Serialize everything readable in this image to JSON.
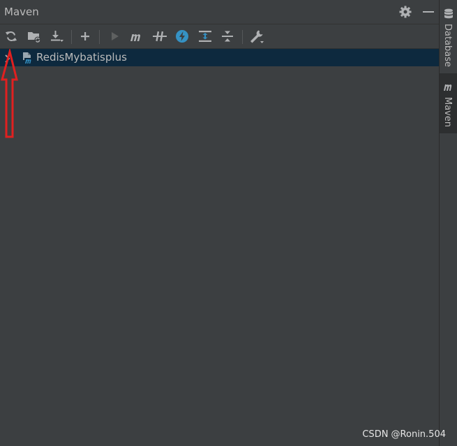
{
  "panel": {
    "title": "Maven"
  },
  "header_actions": [
    {
      "name": "settings",
      "icon": "gear-icon"
    },
    {
      "name": "hide",
      "icon": "minimize-icon"
    }
  ],
  "toolbar": {
    "buttons": [
      {
        "icon": "reload-icon"
      },
      {
        "icon": "generate-sources-icon"
      },
      {
        "icon": "download-icon"
      },
      {
        "icon": "add-icon"
      },
      {
        "icon": "run-icon"
      },
      {
        "icon": "maven-goal-icon"
      },
      {
        "icon": "toggle-offline-icon"
      },
      {
        "icon": "skip-tests-icon"
      },
      {
        "icon": "show-dependencies-icon"
      },
      {
        "icon": "collapse-all-icon"
      },
      {
        "icon": "build-tool-settings-icon"
      }
    ],
    "colors": {
      "icon": "#afb1b3",
      "accent": "#3592c4",
      "disabled": "#5e6060"
    }
  },
  "tree": {
    "items": [
      {
        "label": "RedisMybatisplus",
        "icon": "maven-project-icon",
        "expanded": false,
        "selected": true
      }
    ]
  },
  "side_tabs": [
    {
      "label": "Database",
      "icon": "database-icon",
      "active": false
    },
    {
      "label": "Maven",
      "icon": "maven-icon",
      "active": true
    }
  ],
  "watermark": "CSDN @Ronin.504",
  "annotation": {
    "type": "arrow",
    "color": "#e02020"
  }
}
